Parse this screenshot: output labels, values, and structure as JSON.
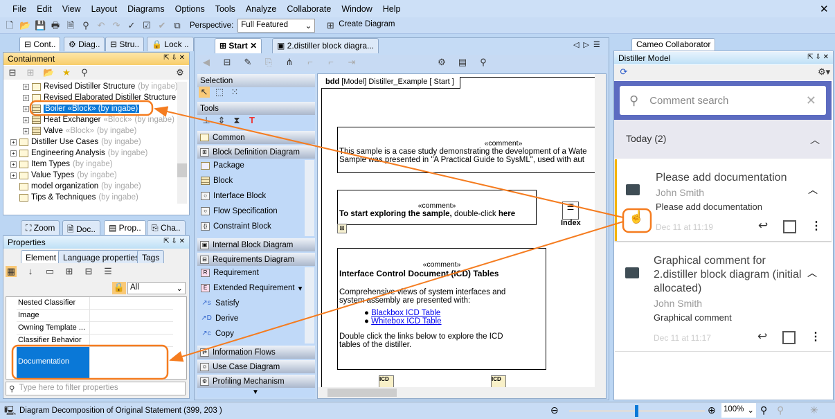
{
  "menu": [
    "File",
    "Edit",
    "View",
    "Layout",
    "Diagrams",
    "Options",
    "Tools",
    "Analyze",
    "Collaborate",
    "Window",
    "Help"
  ],
  "toolbar": {
    "perspective_label": "Perspective:",
    "perspective_value": "Full Featured",
    "create_diagram": "Create Diagram"
  },
  "left_top": {
    "tabs": [
      "Cont..",
      "Diag..",
      "Stru..",
      "Lock .."
    ],
    "title": "Containment",
    "tree": [
      {
        "label": "Revised Distiller Structure",
        "owner": "(by ingabe)",
        "icon": "folder",
        "level": 2
      },
      {
        "label": "Revised Elaborated  Distiller Structure",
        "owner": "",
        "icon": "folder",
        "level": 2
      },
      {
        "label": "Boiler «Block» (by ingabe)",
        "owner": "",
        "icon": "block",
        "level": 2,
        "selected": true
      },
      {
        "label": "Heat Exchanger",
        "stereo": "«Block»",
        "owner": "(by ingabe)",
        "icon": "block",
        "level": 2
      },
      {
        "label": "Valve",
        "stereo": "«Block»",
        "owner": "(by ingabe)",
        "icon": "block",
        "level": 2
      },
      {
        "label": "Distiller Use Cases",
        "owner": "(by ingabe)",
        "icon": "folder",
        "level": 1
      },
      {
        "label": "Engineering Analysis",
        "owner": "(by ingabe)",
        "icon": "folder",
        "level": 1
      },
      {
        "label": "Item Types",
        "owner": "(by ingabe)",
        "icon": "folder",
        "level": 1
      },
      {
        "label": "Value Types",
        "owner": "(by ingabe)",
        "icon": "folder",
        "level": 1
      },
      {
        "label": "model organization",
        "owner": "(by ingabe)",
        "icon": "package-diagram",
        "level": 1
      },
      {
        "label": "Tips & Techniques",
        "owner": "(by ingabe)",
        "icon": "diagram",
        "level": 1
      }
    ]
  },
  "left_bottom": {
    "tabs": [
      "Zoom",
      "Doc..",
      "Prop..",
      "Cha.."
    ],
    "title": "Properties",
    "subtabs": [
      "Element",
      "Language properties",
      "Tags"
    ],
    "filter_value": "All",
    "rows": [
      "Nested Classifier",
      "Image",
      "Owning Template ...",
      "Classifier Behavior"
    ],
    "selected_row": "Documentation",
    "filter_placeholder": "Type here to filter properties"
  },
  "editor": {
    "tabs": [
      "Start",
      "2.distiller block diagra..."
    ],
    "palette": {
      "selection": "Selection",
      "tools": "Tools",
      "common": "Common",
      "bdd": "Block Definition Diagram",
      "bdd_items": [
        "Package",
        "Block",
        "Interface Block",
        "Flow Specification",
        "Constraint Block"
      ],
      "ibd": "Internal Block Diagram",
      "req": "Requirements Diagram",
      "req_items": [
        "Requirement",
        "Extended Requirement",
        "Satisfy",
        "Derive",
        "Copy"
      ],
      "more": [
        "Information Flows",
        "Use Case Diagram",
        "Profiling Mechanism"
      ]
    },
    "diagram": {
      "frame_kind": "bdd",
      "frame_title": "[Model] Distiller_Example [ Start ]",
      "note1": {
        "stereo": "«comment»",
        "line1": "This sample is a case study demonstrating the development of a Wate",
        "line2": "Sample was presented in \"A Practical Guide to SysML\", used with aut"
      },
      "note2": {
        "stereo": "«comment»",
        "bold": "To start exploring the sample,",
        "mid": " double-click ",
        "bold2": "here"
      },
      "index_label": "Index",
      "note3": {
        "stereo": "«comment»",
        "title": "Interface Control Document (ICD) Tables",
        "p1a": "Comprehensive views of system interfaces and",
        "p1b": "system assembly are presented with:",
        "links": [
          "Blackbox ICD Table",
          "Whitebox ICD Table"
        ],
        "p2a": "Double click the links below to explore the ICD",
        "p2b": "tables of the distiller."
      },
      "icd_label": "ICD"
    }
  },
  "collab": {
    "tab": "Cameo Collaborator",
    "title": "Distiller Model",
    "search_placeholder": "Comment search",
    "group": "Today (2)",
    "comments": [
      {
        "title": "Please add documentation",
        "author": "John Smith",
        "body": "Please add documentation",
        "date": "Dec 11 at 11:19"
      },
      {
        "title": "Graphical comment for 2.distiller block diagram (initial allocated)",
        "author": "John Smith",
        "body": "Graphical comment",
        "date": "Dec 11 at 11:17"
      }
    ],
    "accent": "#5c6bc0",
    "highlight": "#f5b400"
  },
  "status": {
    "text": "Diagram Decomposition of Original Statement (399, 203 )",
    "zoom": "100%",
    "zoom_slider": 0.5
  },
  "annotation_color": "#f57c1f"
}
